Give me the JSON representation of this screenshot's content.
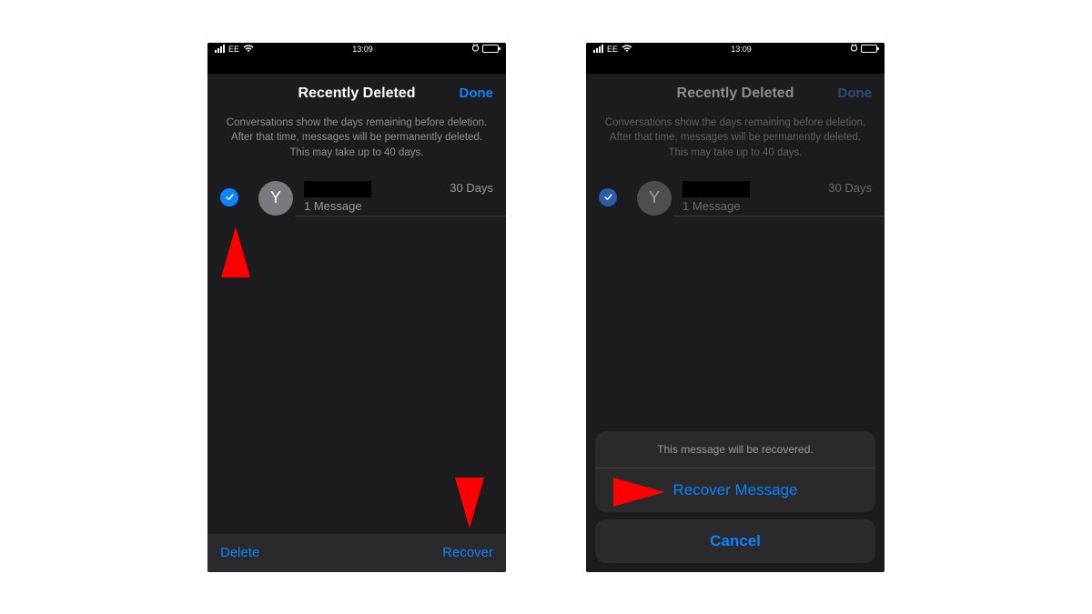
{
  "status_bar": {
    "carrier": "EE",
    "time": "13:09"
  },
  "screen_left": {
    "nav": {
      "title": "Recently Deleted",
      "done": "Done"
    },
    "description": "Conversations show the days remaining before deletion. After that time, messages will be permanently deleted. This may take up to 40 days.",
    "conversation": {
      "avatar_initial": "Y",
      "message_count": "1 Message",
      "days_remaining": "30 Days"
    },
    "toolbar": {
      "delete": "Delete",
      "recover": "Recover"
    }
  },
  "screen_right": {
    "nav": {
      "title": "Recently Deleted",
      "done": "Done"
    },
    "description": "Conversations show the days remaining before deletion. After that time, messages will be permanently deleted. This may take up to 40 days.",
    "conversation": {
      "avatar_initial": "Y",
      "message_count": "1 Message",
      "days_remaining": "30 Days"
    },
    "action_sheet": {
      "header": "This message will be recovered.",
      "recover": "Recover Message",
      "cancel": "Cancel"
    }
  }
}
